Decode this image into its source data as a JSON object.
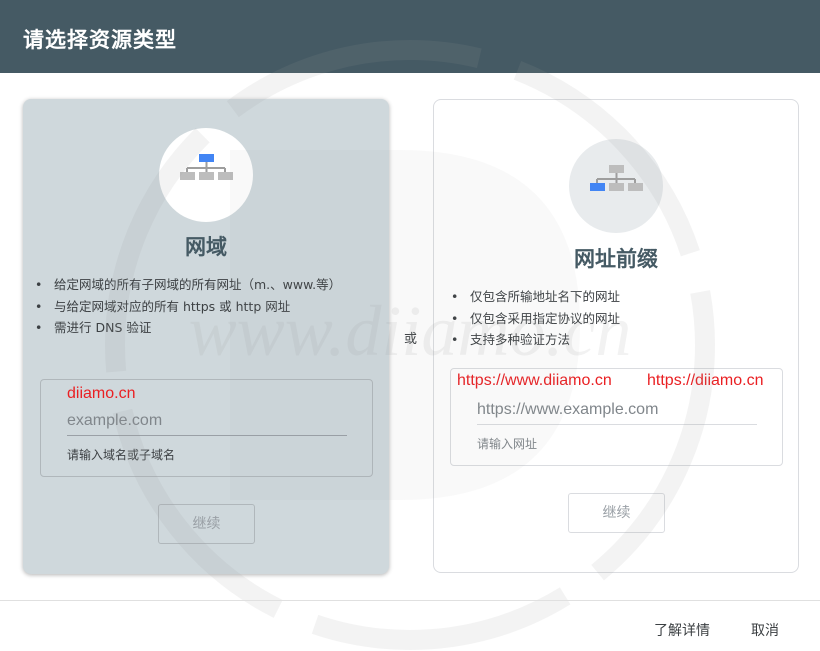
{
  "header": {
    "title": "请选择资源类型"
  },
  "domain_card": {
    "title": "网域",
    "bullets": [
      "给定网域的所有子网域的所有网址（m.、www.等）",
      "与给定网域对应的所有 https 或 http 网址",
      "需进行 DNS 验证"
    ],
    "input": {
      "placeholder": "example.com",
      "helper": "请输入域名或子域名"
    },
    "continue_label": "继续",
    "overlay_text": "diiamo.cn"
  },
  "or_label": "或",
  "prefix_card": {
    "title": "网址前缀",
    "bullets": [
      "仅包含所输地址名下的网址",
      "仅包含采用指定协议的网址",
      "支持多种验证方法"
    ],
    "input": {
      "placeholder": "https://www.example.com",
      "helper": "请输入网址"
    },
    "continue_label": "继续",
    "overlay_text_1": "https://www.diiamo.cn",
    "overlay_text_2": "https://diiamo.cn"
  },
  "watermark": {
    "text": "www.diiamo.cn"
  },
  "footer": {
    "learn_more": "了解详情",
    "cancel": "取消"
  },
  "colors": {
    "header": "#455a64",
    "accent": "#4285f4",
    "selected_card": "#cfd8dc",
    "overlay_red": "#ea1f22"
  },
  "icons": [
    "sitemap-icon-domain",
    "sitemap-icon-prefix"
  ]
}
